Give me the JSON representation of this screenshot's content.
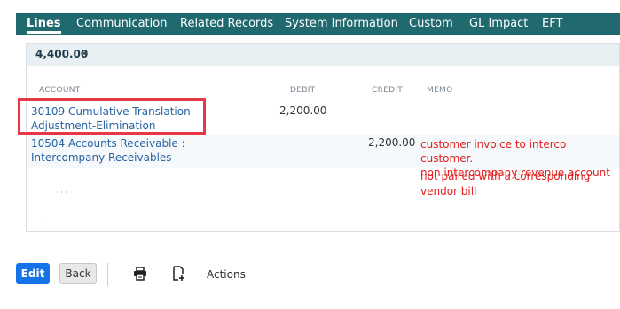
{
  "tabs": [
    {
      "label": "Lines",
      "active": true
    },
    {
      "label": "Communication"
    },
    {
      "label": "Related Records"
    },
    {
      "label": "System Information"
    },
    {
      "label": "Custom"
    },
    {
      "label": "GL Impact"
    },
    {
      "label": "EFT"
    }
  ],
  "summary": {
    "total": "4,400.00",
    "marker": "•"
  },
  "table": {
    "headers": {
      "account": "ACCOUNT",
      "debit": "DEBIT",
      "credit": "CREDIT",
      "memo": "MEMO"
    },
    "rows": [
      {
        "account_line1": "30109 Cumulative Translation",
        "account_line2": "Adjustment-Elimination",
        "debit": "2,200.00",
        "credit": "",
        "memo": ""
      },
      {
        "account_line1": "10504 Accounts Receivable :",
        "account_line2": "Intercompany Receivables",
        "debit": "",
        "credit": "2,200.00",
        "memo_line1": "customer invoice to interco customer.",
        "memo_line2": "non intercompany revenue account"
      }
    ]
  },
  "annotation": {
    "line1": "not paired with a corresponding",
    "line2": "vendor bill",
    "color": "#e0201e",
    "box_color": "#e83746"
  },
  "stray_marks": {
    "a": "· · ·",
    "b": "·"
  },
  "toolbar": {
    "edit": "Edit",
    "back": "Back",
    "actions": "Actions",
    "print_icon": "printer-icon",
    "new_icon": "new-document-icon"
  },
  "colors": {
    "tab_bar": "#20696f",
    "primary": "#1473e6",
    "link": "#2962a3"
  }
}
